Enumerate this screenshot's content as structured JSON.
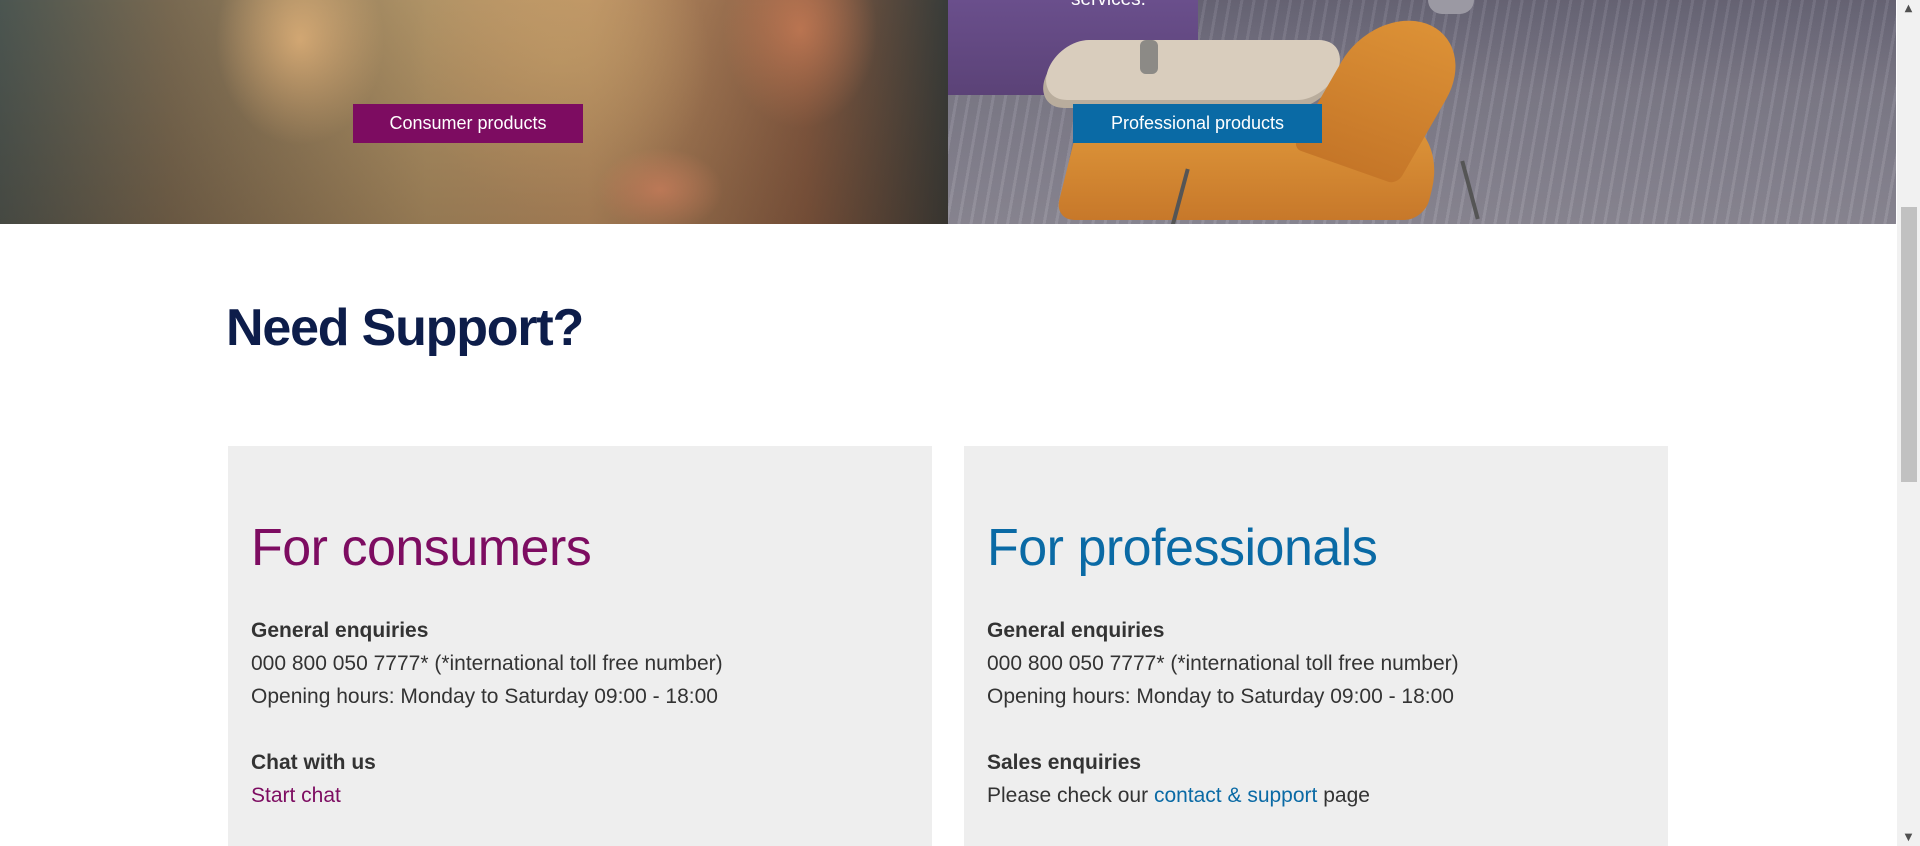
{
  "hero": {
    "professional_text": "services.",
    "consumer_button": "Consumer products",
    "professional_button": "Professional products"
  },
  "support": {
    "heading": "Need Support?",
    "consumers": {
      "title": "For consumers",
      "general_label": "General enquiries",
      "phone": "000 800 050 7777* (*international toll free number)",
      "hours": "Opening hours: Monday to Saturday 09:00 - 18:00",
      "chat_label": "Chat with us",
      "chat_link": "Start chat"
    },
    "professionals": {
      "title": "For professionals",
      "general_label": "General enquiries",
      "phone": "000 800 050 7777* (*international toll free number)",
      "hours": "Opening hours: Monday to Saturday 09:00 - 18:00",
      "sales_label": "Sales enquiries",
      "sales_prefix": "Please check our ",
      "sales_link": "contact & support",
      "sales_suffix": " page"
    }
  },
  "colors": {
    "consumer_accent": "#7d0c61",
    "professional_accent": "#0a6aa5",
    "heading": "#0d1d4a",
    "card_background": "#eeeeee"
  },
  "icons": {
    "scroll_up": "triangle-up-icon",
    "scroll_down": "triangle-down-icon"
  }
}
